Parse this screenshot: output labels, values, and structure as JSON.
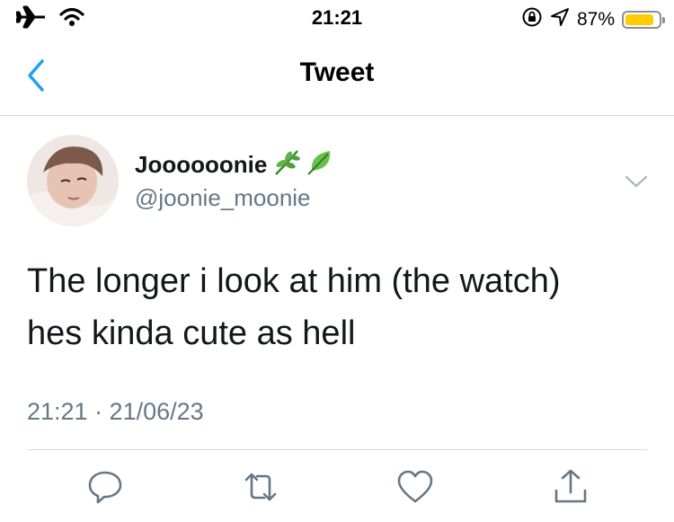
{
  "status_bar": {
    "time": "21:21",
    "battery_percent_label": "87%",
    "battery_level": 0.87,
    "icons": [
      "airplane-icon",
      "wifi-icon",
      "orientation-lock-icon",
      "location-icon",
      "battery-icon"
    ],
    "battery_color": "#ffcc00"
  },
  "nav": {
    "title": "Tweet",
    "back_icon": "chevron-left-icon",
    "accent_color": "#1da1f2"
  },
  "tweet": {
    "author_name": "Joooooonie",
    "author_emoji": "🌿🍃",
    "author_handle": "@joonie_moonie",
    "text_line_1": "The longer i look at him (the watch)",
    "text_line_2": "hes kinda cute as hell",
    "timestamp": "21:21 · 21/06/23",
    "more_icon": "chevron-down-icon"
  },
  "actions": [
    "reply-icon",
    "retweet-icon",
    "like-icon",
    "share-icon"
  ],
  "colors": {
    "text": "#14171a",
    "secondary": "#657786",
    "divider": "#d6d9db",
    "icon": "#657786"
  }
}
